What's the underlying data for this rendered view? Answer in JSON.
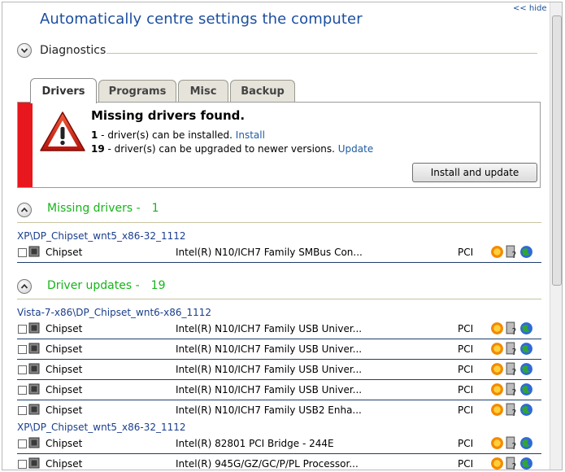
{
  "header": {
    "hide_link": "<< hide",
    "title": "Automatically centre settings the computer"
  },
  "diagnostics": {
    "label": "Diagnostics"
  },
  "tabs": [
    {
      "label": "Drivers",
      "active": true
    },
    {
      "label": "Programs",
      "active": false
    },
    {
      "label": "Misc",
      "active": false
    },
    {
      "label": "Backup",
      "active": false
    }
  ],
  "alert": {
    "title": "Missing drivers found.",
    "line1": {
      "count": "1",
      "text": " - driver(s) can be installed. ",
      "link": "Install"
    },
    "line2": {
      "count": "19",
      "text": " - driver(s) can be upgraded to newer versions. ",
      "link": "Update"
    },
    "button": "Install and update",
    "accent_color": "#e8161d"
  },
  "missing": {
    "label": "Missing drivers -",
    "count": "1",
    "groups": [
      {
        "name": "XP\\DP_Chipset_wnt5_x86-32_1112",
        "rows": [
          {
            "type": "Chipset",
            "name": "Intel(R) N10/ICH7 Family SMBus Con...",
            "bus": "PCI"
          }
        ]
      }
    ]
  },
  "updates": {
    "label": "Driver updates -",
    "count": "19",
    "groups": [
      {
        "name": "Vista-7-x86\\DP_Chipset_wnt6-x86_1112",
        "rows": [
          {
            "type": "Chipset",
            "name": "Intel(R) N10/ICH7 Family USB Univer...",
            "bus": "PCI"
          },
          {
            "type": "Chipset",
            "name": "Intel(R) N10/ICH7 Family USB Univer...",
            "bus": "PCI"
          },
          {
            "type": "Chipset",
            "name": "Intel(R) N10/ICH7 Family USB Univer...",
            "bus": "PCI"
          },
          {
            "type": "Chipset",
            "name": "Intel(R) N10/ICH7 Family USB Univer...",
            "bus": "PCI"
          },
          {
            "type": "Chipset",
            "name": "Intel(R) N10/ICH7 Family USB2 Enha...",
            "bus": "PCI"
          }
        ]
      },
      {
        "name": "XP\\DP_Chipset_wnt5_x86-32_1112",
        "rows": [
          {
            "type": "Chipset",
            "name": "Intel(R) 82801 PCI Bridge - 244E",
            "bus": "PCI"
          },
          {
            "type": "Chipset",
            "name": "Intel(R) 945G/GZ/GC/P/PL Processor...",
            "bus": "PCI"
          }
        ]
      }
    ]
  },
  "colors": {
    "title": "#1b4ea0",
    "section_heading": "#16b41a",
    "group_label": "#1a3e8c",
    "row_separator": "#1e3f6c"
  },
  "icons": {
    "row_actions": [
      "gear-sun-icon",
      "device-info-icon",
      "globe-icon"
    ],
    "row_type": "chip-icon",
    "alert": "warning-triangle-icon"
  }
}
